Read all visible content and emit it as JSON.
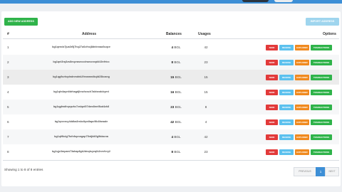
{
  "toolbar": {
    "add_label": "ADD NEW ADDRESS",
    "import_label": "IMPORT ADDRESS"
  },
  "table": {
    "columns": [
      "#",
      "Address",
      "Balances",
      "Usages",
      "Options"
    ],
    "actions": {
      "send": "SEND",
      "receive": "RECEIVE",
      "explorer": "EXPLORER",
      "transactions": "TRANSACTIONS"
    },
    "rows": [
      {
        "idx": "1",
        "address": "bg1qendz7jua3r5j7hq27u6cfncj8dnlnnau0uqce",
        "bal_num": "4",
        "bal_unit": "BGL",
        "usages": "42"
      },
      {
        "idx": "2",
        "address": "bg1qnl3rq3zs8ecpraseccdnwccnxpkl43nfrtcc",
        "bal_num": "8",
        "bal_unit": "BGL",
        "usages": "23"
      },
      {
        "idx": "3",
        "address": "bg1qg9urhqdndnmdnk2fexamndkqld23kcang",
        "bal_num": "15",
        "bal_unit": "BGL",
        "usages": "15"
      },
      {
        "idx": "4",
        "address": "bg1qlv4ayntldrhagdjhnzhcsch7aktsndckymt",
        "bal_num": "16",
        "bal_unit": "BGL",
        "usages": "15"
      },
      {
        "idx": "5",
        "address": "bg1qgfwdhqepzhz7zskpd07dwx8nnf8ud4zk8",
        "bal_num": "23",
        "bal_unit": "BGL",
        "usages": "8"
      },
      {
        "idx": "6",
        "address": "bg1qrcrzoy4ddba3rskcltpnllapc9ik4fanade",
        "bal_num": "42",
        "bal_unit": "BGL",
        "usages": "4"
      },
      {
        "idx": "7",
        "address": "bg1qt9kdg7fofnfopnngap75ntjkt6fg9tdacna",
        "bal_num": "4",
        "bal_unit": "BGL",
        "usages": "42"
      },
      {
        "idx": "8",
        "address": "bg1qjc3mpam73ahap8gk2dnqtsyeqlk2nrvfvry2",
        "bal_num": "8",
        "bal_unit": "BGL",
        "usages": "23"
      }
    ]
  },
  "footer": {
    "entries_text": "Showing 1 to 8 of 8 entries",
    "prev_label": "PREVIOUS",
    "page": "1",
    "next_label": "NEXT"
  },
  "colors": {
    "accent": "#3d8fd6",
    "send": "#e23a3a",
    "receive": "#5cc1ee",
    "explorer": "#f08a1f",
    "transactions": "#2fb34a"
  }
}
